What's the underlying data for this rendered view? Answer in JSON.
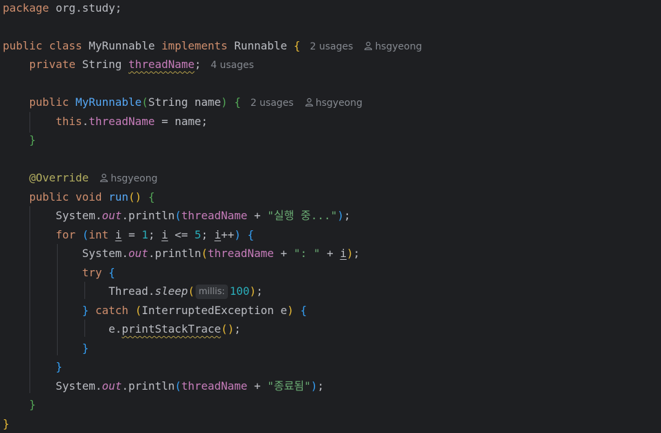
{
  "editor": {
    "file_language": "java",
    "package_line": "package org.study;",
    "lines": {
      "l1": {
        "kw_package": "package",
        "pkg": " org.study;"
      },
      "l3": {
        "kw_public": "public",
        "kw_class": "class",
        "class_name": "MyRunnable",
        "kw_implements": "implements",
        "iface": "Runnable",
        "brace": "{",
        "usages": "2 usages",
        "author": "hsgyeong"
      },
      "l4": {
        "kw_private": "private",
        "type": "String",
        "field": "threadName",
        "semi": ";",
        "usages": "4 usages"
      },
      "l6": {
        "kw_public": "public",
        "ctor": "MyRunnable",
        "open_paren": "(",
        "params": "String name",
        "close_paren": ")",
        "brace": "{",
        "usages": "2 usages",
        "author": "hsgyeong"
      },
      "l7": {
        "kw_this": "this",
        "dot": ".",
        "field": "threadName",
        "rest": " = name;"
      },
      "l8": {
        "brace": "}"
      },
      "l10": {
        "annotation": "@Override",
        "author": "hsgyeong"
      },
      "l11": {
        "kw_public": "public",
        "kw_void": "void",
        "method": "run",
        "parens": "()",
        "brace": "{"
      },
      "l12": {
        "cls": "System",
        "dot1": ".",
        "out": "out",
        "call": ".println",
        "open": "(",
        "field": "threadName",
        "op": " + ",
        "str": "\"실행 중...\"",
        "close": ")",
        "semi": ";"
      },
      "l13": {
        "kw_for": "for",
        "open": "(",
        "kw_int": "int",
        "var1": "i",
        "eq": " = ",
        "n1": "1",
        "semi1": "; ",
        "var2": "i",
        "le": " <= ",
        "n5": "5",
        "semi2": "; ",
        "var3": "i",
        "inc": "++",
        "close": ")",
        "brace": "{"
      },
      "l14": {
        "cls": "System",
        "dot1": ".",
        "out": "out",
        "call": ".println",
        "open": "(",
        "field": "threadName",
        "op": " + ",
        "str": "\": \"",
        "op2": " + ",
        "var": "i",
        "close": ")",
        "semi": ";"
      },
      "l15": {
        "kw_try": "try",
        "brace": "{"
      },
      "l16": {
        "cls": "Thread",
        "dot": ".",
        "method": "sleep",
        "open": "(",
        "param_hint": "millis:",
        "num": "100",
        "close": ")",
        "semi": ";"
      },
      "l17": {
        "close_brace": "}",
        "kw_catch": "catch",
        "open": "(",
        "exc": "InterruptedException e",
        "close": ")",
        "brace": "{"
      },
      "l18": {
        "var": "e",
        "dot": ".",
        "method": "printStackTrace",
        "parens": "()",
        "semi": ";"
      },
      "l19": {
        "brace": "}"
      },
      "l20": {
        "brace": "}"
      },
      "l21": {
        "cls": "System",
        "dot1": ".",
        "out": "out",
        "call": ".println",
        "open": "(",
        "field": "threadName",
        "op": " + ",
        "str": "\"종료됨\"",
        "close": ")",
        "semi": ";"
      },
      "l22": {
        "brace": "}"
      },
      "l23": {
        "brace": "}"
      }
    },
    "colors": {
      "background": "#1e1f22",
      "keyword": "#cf8e6d",
      "field": "#c77dbb",
      "declaration": "#56a8f5",
      "string": "#6aab73",
      "number": "#2aacb8",
      "annotation": "#b3ae60",
      "hint": "#868a91"
    },
    "icons": {
      "author": "user-icon"
    }
  }
}
